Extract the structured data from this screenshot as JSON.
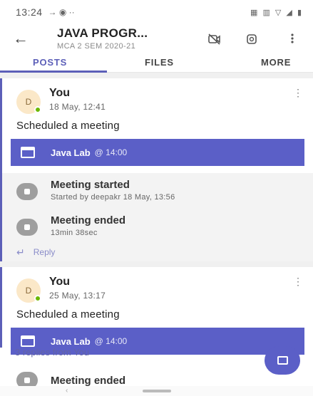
{
  "status_bar": {
    "time": "13:24",
    "left_icons": "→ ◉ ··",
    "right_icons": "▦ ▥ ▽ ◢ ▮"
  },
  "header": {
    "title": "JAVA PROGR...",
    "subtitle": "MCA 2 SEM 2020-21",
    "back_icon": "←"
  },
  "tabs": [
    {
      "label": "POSTS",
      "active": true
    },
    {
      "label": "FILES",
      "active": false
    },
    {
      "label": "MORE",
      "active": false
    }
  ],
  "posts": [
    {
      "avatar": "D",
      "author": "You",
      "timestamp": "18 May, 12:41",
      "text": "Scheduled a meeting",
      "meeting_title": "Java Lab",
      "meeting_time": "@ 14:00",
      "events": [
        {
          "title": "Meeting started",
          "detail": "Started by deepakr   18 May, 13:56"
        },
        {
          "title": "Meeting ended",
          "detail": "13min 38sec"
        }
      ],
      "reply_label": "Reply"
    },
    {
      "avatar": "D",
      "author": "You",
      "timestamp": "25 May, 13:17",
      "text": "Scheduled a meeting",
      "meeting_title": "Java Lab",
      "meeting_time": "@ 14:00",
      "replies_link": "3 replies from You",
      "partial_event": "Meeting ended"
    }
  ],
  "colors": {
    "accent": "#5b5fc7",
    "presence": "#6bb700",
    "avatar_bg": "#fbe8c8"
  }
}
